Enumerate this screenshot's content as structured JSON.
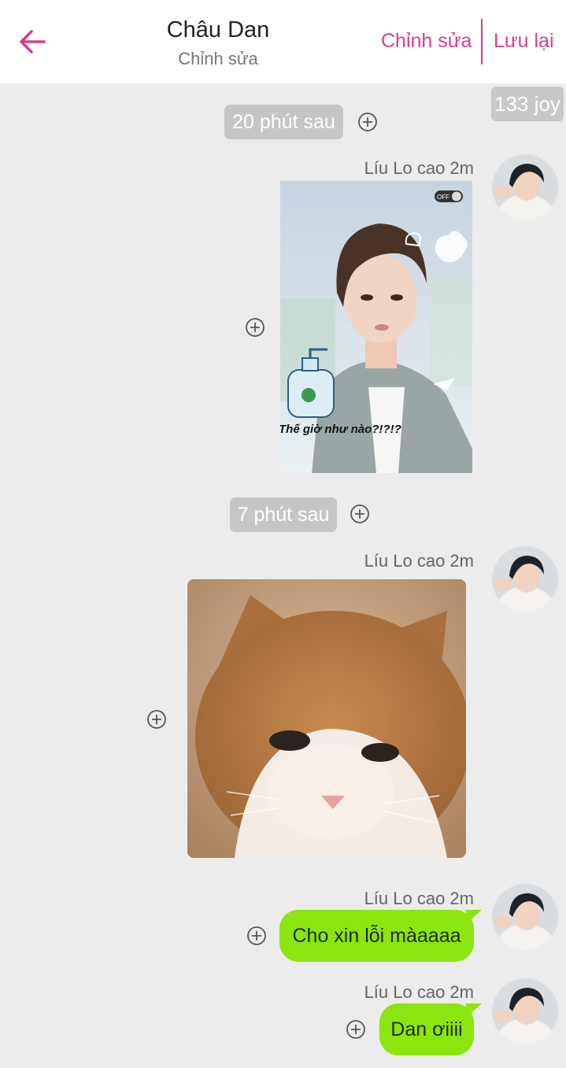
{
  "header": {
    "title": "Châu Dan",
    "subtitle": "Chỉnh sửa",
    "edit_label": "Chỉnh sửa",
    "save_label": "Lưu lại"
  },
  "joy_badge": "133 joy",
  "separators": [
    "20 phút sau",
    "7 phút sau"
  ],
  "messages": [
    {
      "sender": "Líu Lo cao 2m",
      "type": "image",
      "image": "meme-photo",
      "caption": "Thế giờ như nào?!?!?"
    },
    {
      "sender": "Líu Lo cao 2m",
      "type": "image",
      "image": "sad-kitten-photo"
    },
    {
      "sender": "Líu Lo cao 2m",
      "type": "text",
      "text": "Cho xin lỗi màaaaa"
    },
    {
      "sender": "Líu Lo cao 2m",
      "type": "text",
      "text": "Dan ơiiii"
    }
  ],
  "colors": {
    "accent": "#d63d8f",
    "bubble": "#8ce50d",
    "background": "#ececec",
    "pill": "#c6c6c6"
  },
  "icons": {
    "back": "back-arrow-icon",
    "add": "add-circle-icon"
  }
}
